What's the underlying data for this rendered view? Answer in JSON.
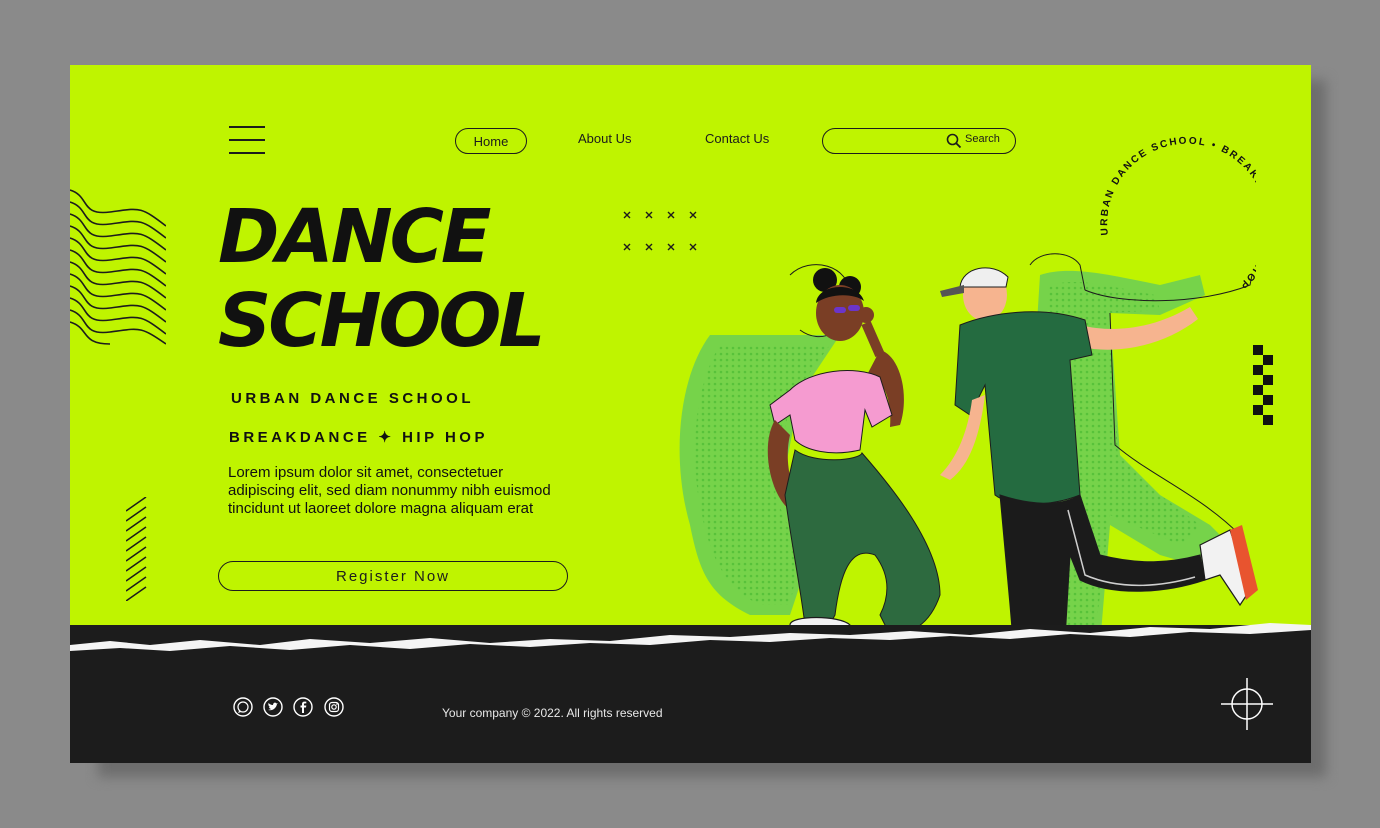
{
  "header": {
    "nav": {
      "home": "Home",
      "about": "About Us",
      "contact": "Contact Us"
    },
    "search": {
      "label": "Search",
      "icon": "search-icon"
    }
  },
  "hero": {
    "title_line1": "DANCE",
    "title_line2": "SCHOOL",
    "subtitle1": "URBAN DANCE SCHOOL",
    "subtitle2": "BREAKDANCE ✦ HIP HOP",
    "description": "Lorem ipsum dolor sit amet, consectetuer adipiscing elit, sed diam nonummy nibh euismod tincidunt ut laoreet dolore magna aliquam erat",
    "register_label": "Register Now"
  },
  "badge": {
    "circular_text": "URBAN DANCE SCHOOL • BREAKDANCE • HIP HOP"
  },
  "footer": {
    "social_icons": [
      "whatsapp-icon",
      "twitter-icon",
      "facebook-icon",
      "instagram-icon"
    ],
    "copyright": "Your company © 2022. All rights reserved"
  },
  "colors": {
    "background": "#bff400",
    "dark": "#1c1c1c",
    "shirt_pink": "#f59bd0",
    "shirt_green": "#246b40",
    "pants_green": "#2d6a3f"
  }
}
